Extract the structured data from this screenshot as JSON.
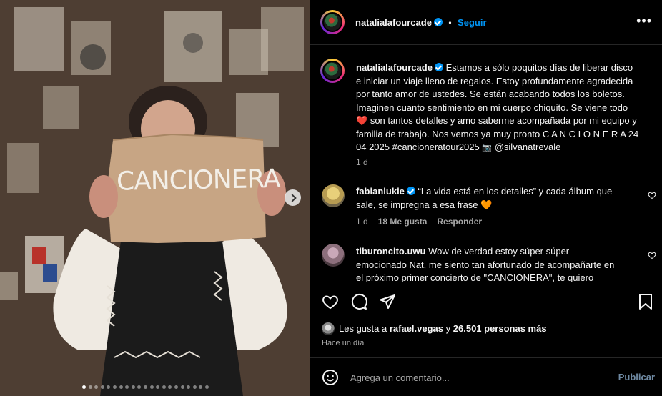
{
  "post": {
    "sign_text": "CANCIONERA",
    "carousel_total": 21,
    "carousel_active": 0
  },
  "header": {
    "username": "natalialafourcade",
    "separator": "•",
    "follow_label": "Seguir",
    "more_icon": "more-dots-icon"
  },
  "caption": {
    "username": "natalialafourcade",
    "text_1": "Estamos a sólo poquitos días de liberar disco e iniciar un viaje lleno de regalos. Estoy profundamente agradecida por tanto amor de ustedes. Se están acabando todos los boletos. Imaginen cuanto sentimiento en mi cuerpo chiquito. Se viene todo",
    "text_2": "son tantos detalles y amo saberme acompañada por mi equipo y familia de trabajo. Nos vemos ya muy pronto C A N C I O N E R A 24 04 2025 #cancioneratour2025",
    "mention": "@silvanatrevale",
    "time": "1 d"
  },
  "comments": [
    {
      "username": "fabianlukie",
      "text": "“La vida está en los detalles” y cada álbum que sale, se impregna a esa frase",
      "time": "1 d",
      "likes": "18 Me gusta",
      "reply": "Responder"
    },
    {
      "username": "tiburoncito.uwu",
      "text": "Wow de verdad estoy súper súper emocionado Nat, me siento tan afortunado de acompañarte en el próximo primer concierto de \"CANCIONERA\", te quiero"
    }
  ],
  "likes": {
    "prefix": "Les gusta a",
    "user": "rafael.vegas",
    "middle": "y",
    "count": "26.501 personas más"
  },
  "posted_time": "Hace un día",
  "composer": {
    "placeholder": "Agrega un comentario...",
    "publish_label": "Publicar"
  },
  "colors": {
    "accent": "#0095f6",
    "heart": "#ed4956",
    "orange_heart": "#f6893b"
  }
}
